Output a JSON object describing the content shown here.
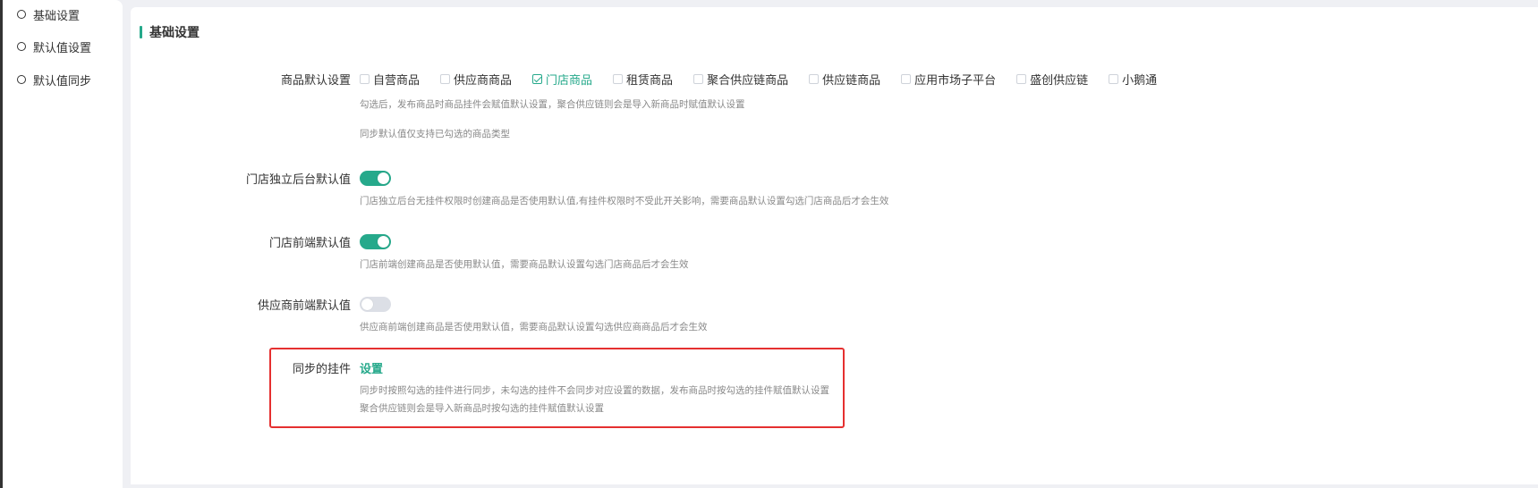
{
  "sidebar": {
    "items": [
      {
        "label": "基础设置"
      },
      {
        "label": "默认值设置"
      },
      {
        "label": "默认值同步"
      }
    ]
  },
  "section": {
    "title": "基础设置"
  },
  "product_default": {
    "label": "商品默认设置",
    "options": [
      {
        "label": "自营商品",
        "checked": false
      },
      {
        "label": "供应商商品",
        "checked": false
      },
      {
        "label": "门店商品",
        "checked": true
      },
      {
        "label": "租赁商品",
        "checked": false
      },
      {
        "label": "聚合供应链商品",
        "checked": false
      },
      {
        "label": "供应链商品",
        "checked": false
      },
      {
        "label": "应用市场子平台",
        "checked": false
      },
      {
        "label": "盛创供应链",
        "checked": false
      },
      {
        "label": "小鹅通",
        "checked": false
      }
    ],
    "hint1": "勾选后，发布商品时商品挂件会赋值默认设置，聚合供应链则会是导入新商品时赋值默认设置",
    "hint2": "同步默认值仅支持已勾选的商品类型"
  },
  "store_backend_default": {
    "label": "门店独立后台默认值",
    "on": true,
    "hint": "门店独立后台无挂件权限时创建商品是否使用默认值,有挂件权限时不受此开关影响，需要商品默认设置勾选门店商品后才会生效"
  },
  "store_frontend_default": {
    "label": "门店前端默认值",
    "on": true,
    "hint": "门店前端创建商品是否使用默认值，需要商品默认设置勾选门店商品后才会生效"
  },
  "supplier_frontend_default": {
    "label": "供应商前端默认值",
    "on": false,
    "hint": "供应商前端创建商品是否使用默认值，需要商品默认设置勾选供应商商品后才会生效"
  },
  "sync_widgets": {
    "label": "同步的挂件",
    "link": "设置",
    "hint1": "同步时按照勾选的挂件进行同步，未勾选的挂件不会同步对应设置的数据，发布商品时按勾选的挂件赋值默认设置",
    "hint2": "聚合供应链则会是导入新商品时按勾选的挂件赋值默认设置"
  },
  "colors": {
    "accent": "#26a98b",
    "highlight": "#e53030"
  }
}
